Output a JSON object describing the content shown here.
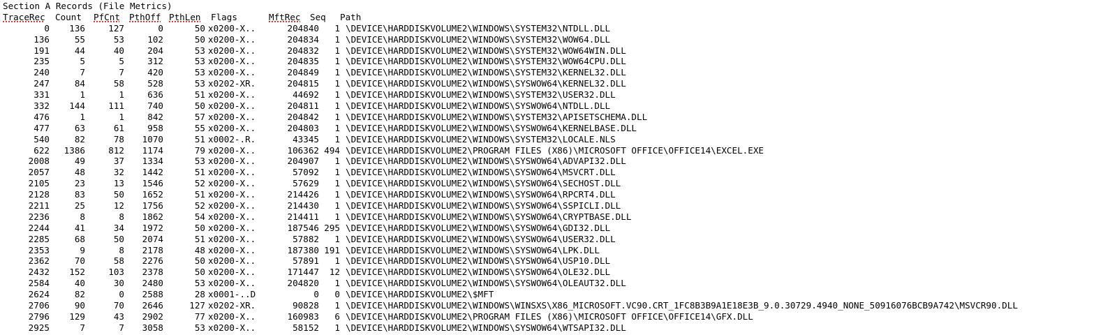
{
  "section_title": "Section A Records (File Metrics)",
  "columns": [
    "TraceRec",
    "Count",
    "PfCnt",
    "PthOff",
    "PthLen",
    "Flags",
    "MftRec",
    "Seq",
    "Path"
  ],
  "spellcheck_flagged_headers": [
    "TraceRec",
    "PfCnt",
    "PthOff",
    "PthLen",
    "MftRec"
  ],
  "records": [
    [
      "0",
      "136",
      "127",
      "0",
      "50",
      "x0200-X..",
      "204840",
      "1",
      "\\DEVICE\\HARDDISKVOLUME2\\WINDOWS\\SYSTEM32\\NTDLL.DLL"
    ],
    [
      "136",
      "55",
      "53",
      "102",
      "50",
      "x0200-X..",
      "204834",
      "1",
      "\\DEVICE\\HARDDISKVOLUME2\\WINDOWS\\SYSTEM32\\WOW64.DLL"
    ],
    [
      "191",
      "44",
      "40",
      "204",
      "53",
      "x0200-X..",
      "204832",
      "1",
      "\\DEVICE\\HARDDISKVOLUME2\\WINDOWS\\SYSTEM32\\WOW64WIN.DLL"
    ],
    [
      "235",
      "5",
      "5",
      "312",
      "53",
      "x0200-X..",
      "204835",
      "1",
      "\\DEVICE\\HARDDISKVOLUME2\\WINDOWS\\SYSTEM32\\WOW64CPU.DLL"
    ],
    [
      "240",
      "7",
      "7",
      "420",
      "53",
      "x0200-X..",
      "204849",
      "1",
      "\\DEVICE\\HARDDISKVOLUME2\\WINDOWS\\SYSTEM32\\KERNEL32.DLL"
    ],
    [
      "247",
      "84",
      "58",
      "528",
      "53",
      "x0202-XR.",
      "204815",
      "1",
      "\\DEVICE\\HARDDISKVOLUME2\\WINDOWS\\SYSWOW64\\KERNEL32.DLL"
    ],
    [
      "331",
      "1",
      "1",
      "636",
      "51",
      "x0200-X..",
      "44692",
      "1",
      "\\DEVICE\\HARDDISKVOLUME2\\WINDOWS\\SYSTEM32\\USER32.DLL"
    ],
    [
      "332",
      "144",
      "111",
      "740",
      "50",
      "x0200-X..",
      "204811",
      "1",
      "\\DEVICE\\HARDDISKVOLUME2\\WINDOWS\\SYSWOW64\\NTDLL.DLL"
    ],
    [
      "476",
      "1",
      "1",
      "842",
      "57",
      "x0200-X..",
      "204842",
      "1",
      "\\DEVICE\\HARDDISKVOLUME2\\WINDOWS\\SYSTEM32\\APISETSCHEMA.DLL"
    ],
    [
      "477",
      "63",
      "61",
      "958",
      "55",
      "x0200-X..",
      "204803",
      "1",
      "\\DEVICE\\HARDDISKVOLUME2\\WINDOWS\\SYSWOW64\\KERNELBASE.DLL"
    ],
    [
      "540",
      "82",
      "78",
      "1070",
      "51",
      "x0002-.R.",
      "43345",
      "1",
      "\\DEVICE\\HARDDISKVOLUME2\\WINDOWS\\SYSTEM32\\LOCALE.NLS"
    ],
    [
      "622",
      "1386",
      "812",
      "1174",
      "79",
      "x0200-X..",
      "106362",
      "494",
      "\\DEVICE\\HARDDISKVOLUME2\\PROGRAM FILES (X86)\\MICROSOFT OFFICE\\OFFICE14\\EXCEL.EXE"
    ],
    [
      "2008",
      "49",
      "37",
      "1334",
      "53",
      "x0200-X..",
      "204907",
      "1",
      "\\DEVICE\\HARDDISKVOLUME2\\WINDOWS\\SYSWOW64\\ADVAPI32.DLL"
    ],
    [
      "2057",
      "48",
      "32",
      "1442",
      "51",
      "x0200-X..",
      "57092",
      "1",
      "\\DEVICE\\HARDDISKVOLUME2\\WINDOWS\\SYSWOW64\\MSVCRT.DLL"
    ],
    [
      "2105",
      "23",
      "13",
      "1546",
      "52",
      "x0200-X..",
      "57629",
      "1",
      "\\DEVICE\\HARDDISKVOLUME2\\WINDOWS\\SYSWOW64\\SECHOST.DLL"
    ],
    [
      "2128",
      "83",
      "50",
      "1652",
      "51",
      "x0200-X..",
      "214426",
      "1",
      "\\DEVICE\\HARDDISKVOLUME2\\WINDOWS\\SYSWOW64\\RPCRT4.DLL"
    ],
    [
      "2211",
      "25",
      "12",
      "1756",
      "52",
      "x0200-X..",
      "214430",
      "1",
      "\\DEVICE\\HARDDISKVOLUME2\\WINDOWS\\SYSWOW64\\SSPICLI.DLL"
    ],
    [
      "2236",
      "8",
      "8",
      "1862",
      "54",
      "x0200-X..",
      "214411",
      "1",
      "\\DEVICE\\HARDDISKVOLUME2\\WINDOWS\\SYSWOW64\\CRYPTBASE.DLL"
    ],
    [
      "2244",
      "41",
      "34",
      "1972",
      "50",
      "x0200-X..",
      "187546",
      "295",
      "\\DEVICE\\HARDDISKVOLUME2\\WINDOWS\\SYSWOW64\\GDI32.DLL"
    ],
    [
      "2285",
      "68",
      "50",
      "2074",
      "51",
      "x0200-X..",
      "57882",
      "1",
      "\\DEVICE\\HARDDISKVOLUME2\\WINDOWS\\SYSWOW64\\USER32.DLL"
    ],
    [
      "2353",
      "9",
      "8",
      "2178",
      "48",
      "x0200-X..",
      "187380",
      "191",
      "\\DEVICE\\HARDDISKVOLUME2\\WINDOWS\\SYSWOW64\\LPK.DLL"
    ],
    [
      "2362",
      "70",
      "58",
      "2276",
      "50",
      "x0200-X..",
      "57891",
      "1",
      "\\DEVICE\\HARDDISKVOLUME2\\WINDOWS\\SYSWOW64\\USP10.DLL"
    ],
    [
      "2432",
      "152",
      "103",
      "2378",
      "50",
      "x0200-X..",
      "171447",
      "12",
      "\\DEVICE\\HARDDISKVOLUME2\\WINDOWS\\SYSWOW64\\OLE32.DLL"
    ],
    [
      "2584",
      "40",
      "30",
      "2480",
      "53",
      "x0200-X..",
      "204820",
      "1",
      "\\DEVICE\\HARDDISKVOLUME2\\WINDOWS\\SYSWOW64\\OLEAUT32.DLL"
    ],
    [
      "2624",
      "82",
      "0",
      "2588",
      "28",
      "x0001-..D",
      "0",
      "0",
      "\\DEVICE\\HARDDISKVOLUME2\\$MFT"
    ],
    [
      "2706",
      "90",
      "70",
      "2646",
      "127",
      "x0202-XR.",
      "90828",
      "1",
      "\\DEVICE\\HARDDISKVOLUME2\\WINDOWS\\WINSXS\\X86_MICROSOFT.VC90.CRT_1FC8B3B9A1E18E3B_9.0.30729.4940_NONE_50916076BCB9A742\\MSVCR90.DLL"
    ],
    [
      "2796",
      "129",
      "43",
      "2902",
      "77",
      "x0200-X..",
      "160983",
      "6",
      "\\DEVICE\\HARDDISKVOLUME2\\PROGRAM FILES (X86)\\MICROSOFT OFFICE\\OFFICE14\\GFX.DLL"
    ],
    [
      "2925",
      "7",
      "7",
      "3058",
      "53",
      "x0200-X..",
      "58152",
      "1",
      "\\DEVICE\\HARDDISKVOLUME2\\WINDOWS\\SYSWOW64\\WTSAPI32.DLL"
    ]
  ]
}
